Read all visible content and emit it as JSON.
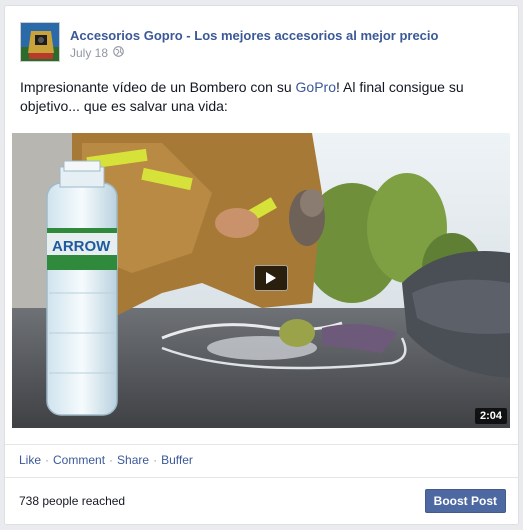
{
  "post": {
    "page_name": "Accesorios Gopro - Los mejores accesorios al mejor precio",
    "date": "July 18",
    "privacy_icon": "globe-icon",
    "text_before": "Impresionante vídeo de un Bombero con su ",
    "text_link": "GoPro",
    "text_after": "! Al final consigue su objetivo... que es salvar una vida:"
  },
  "video": {
    "duration": "2:04",
    "bottle_label": "ARROW"
  },
  "actions": {
    "like": "Like",
    "comment": "Comment",
    "share": "Share",
    "buffer": "Buffer",
    "separator": "·"
  },
  "footer": {
    "reach": "738 people reached",
    "boost": "Boost Post"
  },
  "colors": {
    "link": "#3b5998",
    "meta": "#9197a3",
    "boost_bg": "#4e69a2"
  }
}
